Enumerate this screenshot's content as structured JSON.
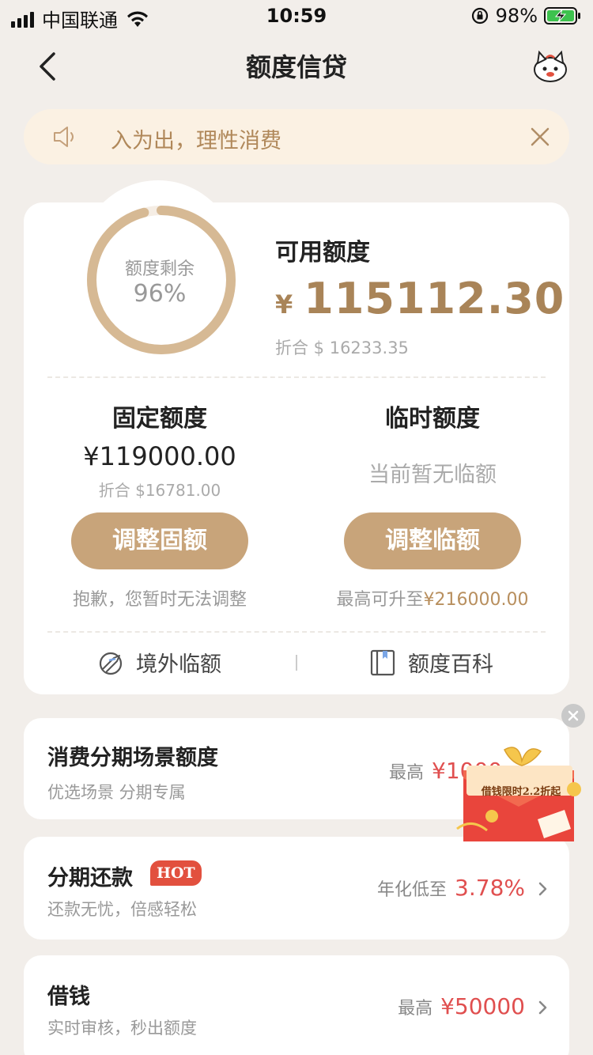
{
  "status_bar": {
    "carrier": "中国联通",
    "time": "10:59",
    "battery_percent": "98%"
  },
  "nav": {
    "title": "额度信贷",
    "back_icon": "chevron-left-icon",
    "mascot_icon": "mascot-avatar-icon"
  },
  "notice": {
    "text": "入为出，理性消费",
    "icon": "speaker-icon",
    "close_icon": "close-icon"
  },
  "summary": {
    "ring_label": "额度剩余",
    "ring_percent": "96%",
    "ring_value": 0.96,
    "available_title": "可用额度",
    "currency_symbol": "¥",
    "available_amount": "115112.30",
    "available_usd": "折合 $ 16233.35",
    "ring_color": "#d6b994",
    "accent_color": "#a98458"
  },
  "fixed": {
    "title": "固定额度",
    "amount": "¥119000.00",
    "usd": "折合 $16781.00",
    "button": "调整固额",
    "note": "抱歉，您暂时无法调整"
  },
  "temporary": {
    "title": "临时额度",
    "status": "当前暂无临额",
    "button": "调整临额",
    "note_prefix": "最高可升至",
    "note_amount": "¥216000.00"
  },
  "links": {
    "overseas": "境外临额",
    "encyclopedia": "额度百科"
  },
  "list": [
    {
      "title": "消费分期场景额度",
      "subtitle": "优选场景 分期专属",
      "right_label": "最高",
      "right_value": "¥1000"
    },
    {
      "title": "分期还款",
      "badge": "HOT",
      "subtitle": "还款无忧，倍感轻松",
      "right_label": "年化低至",
      "right_value": "3.78%"
    },
    {
      "title": "借钱",
      "subtitle": "实时审核，秒出额度",
      "right_label": "最高",
      "right_value": "¥50000"
    }
  ],
  "promo": {
    "text": "借钱限时2.2折起",
    "icon": "red-envelope-icon"
  }
}
